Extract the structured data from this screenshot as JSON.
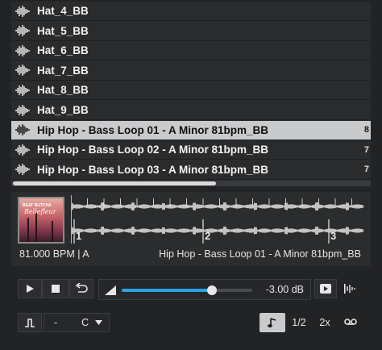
{
  "file_list": {
    "items": [
      {
        "label": "Hat_4_BB",
        "tail": "",
        "selected": false
      },
      {
        "label": "Hat_5_BB",
        "tail": "",
        "selected": false
      },
      {
        "label": "Hat_6_BB",
        "tail": "",
        "selected": false
      },
      {
        "label": "Hat_7_BB",
        "tail": "",
        "selected": false
      },
      {
        "label": "Hat_8_BB",
        "tail": "",
        "selected": false
      },
      {
        "label": "Hat_9_BB",
        "tail": "",
        "selected": false
      },
      {
        "label": "Hip Hop - Bass Loop 01 - A Minor 81bpm_BB",
        "tail": "8",
        "selected": true
      },
      {
        "label": "Hip Hop - Bass Loop 02 - A Minor 81bpm_BB",
        "tail": "7",
        "selected": false
      },
      {
        "label": "Hip Hop - Bass Loop 03 - A Minor 81bpm_BB",
        "tail": "7",
        "selected": false
      }
    ],
    "item_icon": "audio-waveform-icon",
    "scroll_position": 0.57
  },
  "preview": {
    "artwork": {
      "title_text": "BEAT BUTCHA",
      "script_text": "Bellefleur"
    },
    "bar_markers": [
      "1",
      "2",
      "3"
    ],
    "bpm_key": "81.000 BPM | A",
    "file_name": "Hip Hop - Bass Loop 01 - A Minor 81bpm_BB"
  },
  "transport": {
    "play_icon": "play-icon",
    "stop_icon": "stop-icon",
    "loop_icon": "loop-icon",
    "volume_icon": "volume-ramp-icon",
    "volume_level": 0.69,
    "volume_db": "-3.00 dB",
    "auto_play_icon": "auto-play-icon",
    "waveform_toggle_icon": "waveform-toggle-icon"
  },
  "bottom_bar": {
    "pitch_icon": "pulse-icon",
    "pitch_value": "-",
    "key_value": "C",
    "speed_options": [
      {
        "label": "",
        "icon": "music-note-icon",
        "active": true
      },
      {
        "label": "1/2",
        "active": false
      },
      {
        "label": "2x",
        "active": false
      },
      {
        "label": "",
        "icon": "tape-icon",
        "active": false
      }
    ]
  },
  "colors": {
    "accent": "#2aa3e0",
    "selected_row": "#c9cacc",
    "background": "#222325"
  }
}
